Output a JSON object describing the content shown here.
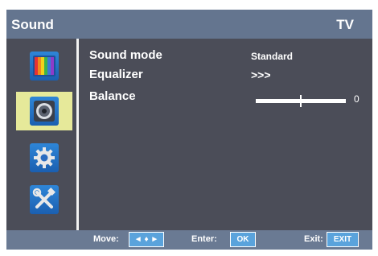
{
  "header": {
    "title": "Sound",
    "source": "TV"
  },
  "sidebar": {
    "items": [
      {
        "icon": "picture-icon",
        "selected": false
      },
      {
        "icon": "speaker-icon",
        "selected": true
      },
      {
        "icon": "gear-icon",
        "selected": false
      },
      {
        "icon": "tools-icon",
        "selected": false
      }
    ]
  },
  "menu": {
    "sound_mode": {
      "label": "Sound mode",
      "value": "Standard"
    },
    "equalizer": {
      "label": "Equalizer",
      "value": ">>>"
    },
    "balance": {
      "label": "Balance",
      "value": "0",
      "level": 0
    }
  },
  "footer": {
    "move_label": "Move:",
    "move_button": "◄ ♦ ►",
    "enter_label": "Enter:",
    "enter_button": "OK",
    "exit_label": "Exit:",
    "exit_button": "EXIT"
  },
  "colors": {
    "header": "#64758f",
    "panel": "#4b4d58",
    "selected": "#e6e99a",
    "footer_button": "#5aa3dc"
  }
}
